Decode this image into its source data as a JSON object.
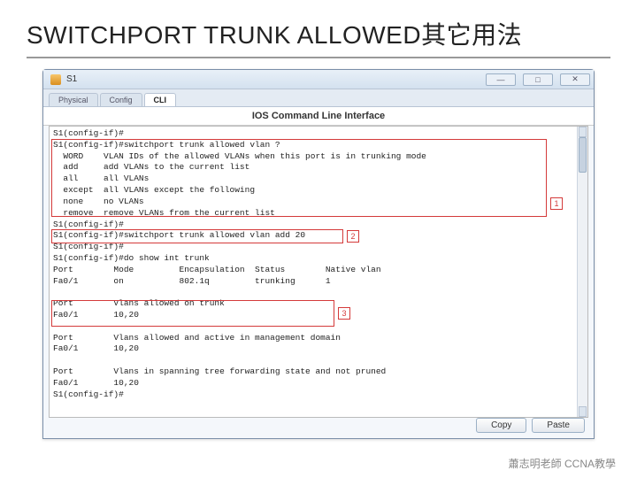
{
  "slide": {
    "title": "SWITCHPORT TRUNK ALLOWED其它用法",
    "footer": "蕭志明老師 CCNA教學"
  },
  "window": {
    "title": "S1",
    "tabs": [
      "Physical",
      "Config",
      "CLI"
    ],
    "active_tab": 2,
    "cli_header": "IOS Command Line Interface",
    "cli_text": "S1(config-if)#\nS1(config-if)#switchport trunk allowed vlan ?\n  WORD    VLAN IDs of the allowed VLANs when this port is in trunking mode\n  add     add VLANs to the current list\n  all     all VLANs\n  except  all VLANs except the following\n  none    no VLANs\n  remove  remove VLANs from the current list\nS1(config-if)#\nS1(config-if)#switchport trunk allowed vlan add 20\nS1(config-if)#\nS1(config-if)#do show int trunk\nPort        Mode         Encapsulation  Status        Native vlan\nFa0/1       on           802.1q         trunking      1\n\nPort        Vlans allowed on trunk\nFa0/1       10,20\n\nPort        Vlans allowed and active in management domain\nFa0/1       10,20\n\nPort        Vlans in spanning tree forwarding state and not pruned\nFa0/1       10,20\nS1(config-if)#",
    "buttons": {
      "copy": "Copy",
      "paste": "Paste"
    }
  },
  "callouts": {
    "c1": "1",
    "c2": "2",
    "c3": "3"
  }
}
